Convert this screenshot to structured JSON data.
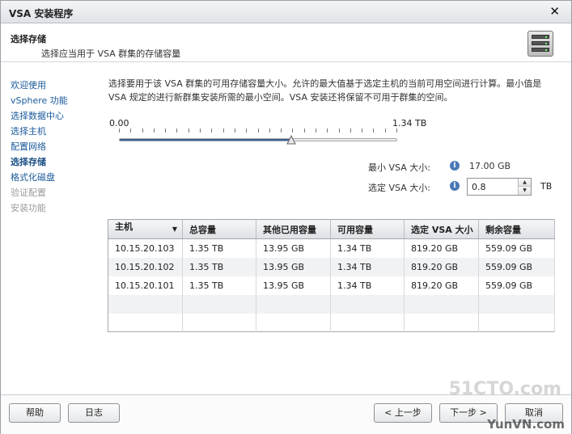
{
  "window": {
    "title": "VSA 安装程序"
  },
  "header": {
    "step_title": "选择存储",
    "step_desc": "选择应当用于 VSA 群集的存储容量",
    "icon": "storage-server-icon"
  },
  "nav": {
    "items": [
      {
        "label": "欢迎使用",
        "state": "link"
      },
      {
        "label": "vSphere 功能",
        "state": "link"
      },
      {
        "label": "选择数据中心",
        "state": "link"
      },
      {
        "label": "选择主机",
        "state": "link"
      },
      {
        "label": "配置网络",
        "state": "link"
      },
      {
        "label": "选择存储",
        "state": "active"
      },
      {
        "label": "格式化磁盘",
        "state": "link"
      },
      {
        "label": "验证配置",
        "state": "disabled"
      },
      {
        "label": "安装功能",
        "state": "disabled"
      }
    ]
  },
  "main": {
    "description": "选择要用于该 VSA 群集的可用存储容量大小。允许的最大值基于选定主机的当前可用空间进行计算。最小值是 VSA 规定的进行新群集安装所需的最小空间。VSA 安装还将保留不可用于群集的空间。",
    "slider": {
      "min_label": "0.00",
      "max_label": "1.34 TB",
      "value_fraction": 0.62
    },
    "min_size": {
      "label": "最小 VSA 大小:",
      "value": "17.00 GB"
    },
    "selected_size": {
      "label": "选定 VSA 大小:",
      "value": "0.8",
      "unit": "TB"
    }
  },
  "table": {
    "columns": [
      "主机",
      "总容量",
      "其他已用容量",
      "可用容量",
      "选定 VSA 大小",
      "剩余容量"
    ],
    "rows": [
      [
        "10.15.20.103",
        "1.35 TB",
        "13.95 GB",
        "1.34 TB",
        "819.20 GB",
        "559.09 GB"
      ],
      [
        "10.15.20.102",
        "1.35 TB",
        "13.95 GB",
        "1.34 TB",
        "819.20 GB",
        "559.09 GB"
      ],
      [
        "10.15.20.101",
        "1.35 TB",
        "13.95 GB",
        "1.34 TB",
        "819.20 GB",
        "559.09 GB"
      ],
      [
        "",
        "",
        "",
        "",
        "",
        ""
      ],
      [
        "",
        "",
        "",
        "",
        "",
        ""
      ]
    ]
  },
  "footer": {
    "help": "帮助",
    "log": "日志",
    "back": "< 上一步",
    "next": "下一步 >",
    "cancel": "取消"
  },
  "watermarks": {
    "top": "51CTO.com",
    "bottom": "YunVN.com"
  },
  "colors": {
    "nav_link": "#1a5a9b",
    "slider_fill": "#3b5f90",
    "info_icon": "#4a79b6"
  }
}
